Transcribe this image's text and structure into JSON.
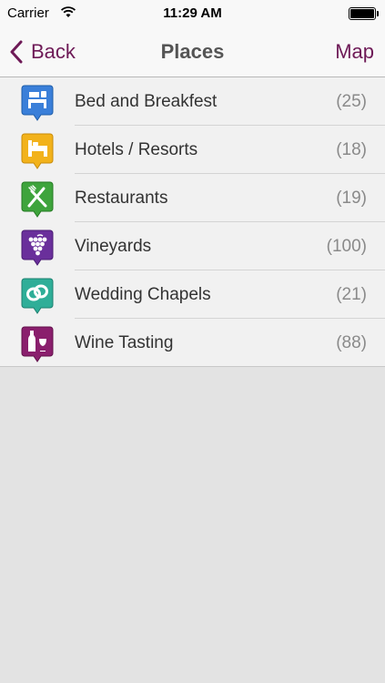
{
  "status_bar": {
    "carrier": "Carrier",
    "time": "11:29 AM"
  },
  "nav": {
    "back_label": "Back",
    "title": "Places",
    "map_label": "Map",
    "tint_color": "#6e1a57"
  },
  "places": [
    {
      "label": "Bed and Breakfest",
      "count": "(25)",
      "icon": "bed-breakfast-icon",
      "color": "#3a7fd9"
    },
    {
      "label": "Hotels / Resorts",
      "count": "(18)",
      "icon": "hotel-icon",
      "color": "#f2b21b"
    },
    {
      "label": "Restaurants",
      "count": "(19)",
      "icon": "restaurant-icon",
      "color": "#3ea43c"
    },
    {
      "label": "Vineyards",
      "count": "(100)",
      "icon": "vineyard-icon",
      "color": "#6a2f9b"
    },
    {
      "label": "Wedding Chapels",
      "count": "(21)",
      "icon": "wedding-rings-icon",
      "color": "#2fae98"
    },
    {
      "label": "Wine Tasting",
      "count": "(88)",
      "icon": "wine-tasting-icon",
      "color": "#8a1f6d"
    }
  ]
}
